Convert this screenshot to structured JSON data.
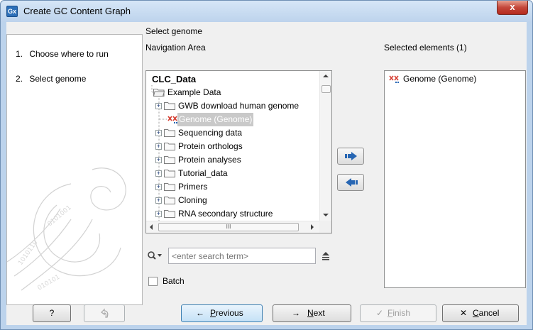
{
  "window": {
    "app_icon_text": "Gx",
    "title": "Create GC Content Graph",
    "close_glyph": "x"
  },
  "wizard_steps": [
    {
      "num": "1.",
      "label": "Choose where to run"
    },
    {
      "num": "2.",
      "label": "Select genome"
    }
  ],
  "main": {
    "section_title": "Select genome",
    "navigation_label": "Navigation Area",
    "selected_label": "Selected elements (1)"
  },
  "tree": {
    "root": "CLC_Data",
    "items": [
      {
        "label": "Example Data",
        "icon": "folder-open-icon"
      },
      {
        "label": "GWB download human genome",
        "icon": "folder-icon"
      },
      {
        "label": "Genome (Genome)",
        "icon": "genome-icon"
      },
      {
        "label": "Sequencing data",
        "icon": "folder-icon"
      },
      {
        "label": "Protein orthologs",
        "icon": "folder-icon"
      },
      {
        "label": "Protein analyses",
        "icon": "folder-icon"
      },
      {
        "label": "Tutorial_data",
        "icon": "folder-icon"
      },
      {
        "label": "Primers",
        "icon": "folder-icon"
      },
      {
        "label": "Cloning",
        "icon": "folder-icon"
      },
      {
        "label": "RNA secondary structure",
        "icon": "folder-icon"
      }
    ],
    "hscroll_thumb_glyph": "III"
  },
  "selected_elements": [
    {
      "label": "Genome (Genome)",
      "icon": "genome-icon"
    }
  ],
  "search": {
    "placeholder": "<enter search term>"
  },
  "batch": {
    "label": "Batch",
    "checked": false
  },
  "footer": {
    "help": "?",
    "previous": "Previous",
    "previous_underline": "P",
    "previous_rest": "revious",
    "next_underline": "N",
    "next_rest": "ext",
    "finish_underline": "F",
    "finish_rest": "inish",
    "cancel_underline": "C",
    "cancel_rest": "ancel"
  },
  "colors": {
    "accent": "#3c7fb1",
    "selection": "#c9c9c9",
    "arrow_blue": "#2766b3"
  }
}
